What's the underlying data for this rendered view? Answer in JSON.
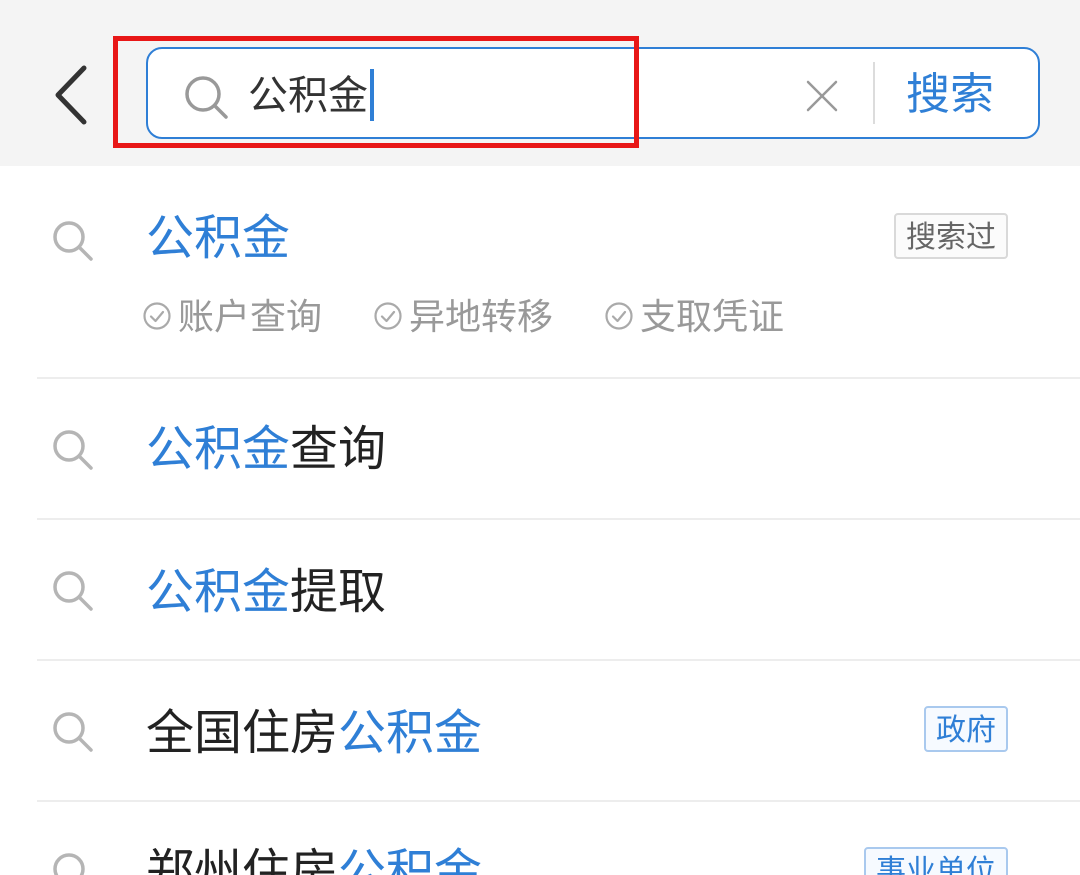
{
  "search": {
    "value": "公积金",
    "button_label": "搜索"
  },
  "suggestions": [
    {
      "prefix": "",
      "highlight": "公积金",
      "suffix": "",
      "tag": "搜索过",
      "chips": [
        "账户查询",
        "异地转移",
        "支取凭证"
      ]
    },
    {
      "prefix": "",
      "highlight": "公积金",
      "suffix": "查询",
      "tag": ""
    },
    {
      "prefix": "",
      "highlight": "公积金",
      "suffix": "提取",
      "tag": ""
    },
    {
      "prefix": "全国住房",
      "highlight": "公积金",
      "suffix": "",
      "tag": "政府"
    },
    {
      "prefix": "郑州住房",
      "highlight": "公积金",
      "suffix": "",
      "tag": "事业单位"
    }
  ],
  "icons": {
    "back": "chevron-left-icon",
    "search": "search-icon",
    "clear": "close-icon",
    "chip": "check-circle-icon"
  },
  "colors": {
    "accent": "#2f7fd6",
    "annotation": "#e81717",
    "header_bg": "#f4f4f4"
  }
}
